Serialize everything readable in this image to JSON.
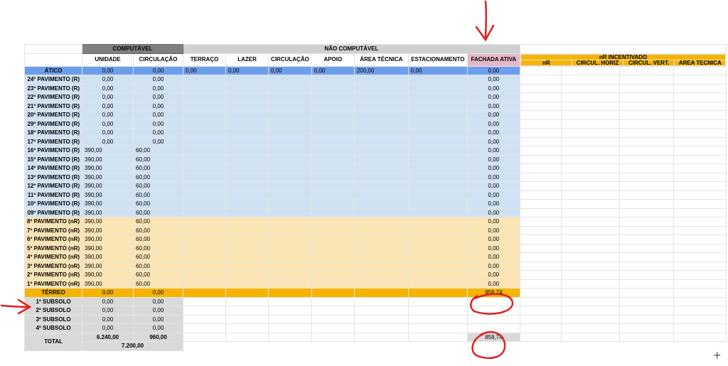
{
  "header": {
    "computavel": "COMPUTÁVEL",
    "nao_computavel": "NÃO COMPUTÁVEL",
    "nr_incentivado": "nR INCENTIVADO",
    "cols": [
      "UNIDADE",
      "CIRCULAÇÃO",
      "TERRAÇO",
      "LAZER",
      "CIRCULAÇÃO",
      "APOIO",
      "ÁREA TÉCNICA",
      "ESTACIONAMENTO",
      "FACHADA ATIVA"
    ],
    "nr_cols": [
      "nR",
      "CIRCUL. HORIZ",
      "CIRCUL. VERT.",
      "ÁREA TÉCNICA"
    ]
  },
  "rows": [
    {
      "label": "ÁTICO",
      "type": "atico",
      "unidade": "0,00",
      "circulacao": "0,00",
      "terraco": "0,00",
      "lazer": "0,00",
      "circ2": "0,00",
      "apoio": "0,00",
      "area_tecnica": "200,00",
      "estac": "0,00",
      "fachada": "0,00"
    },
    {
      "label": "24º PAVIMENTO (R)",
      "type": "r",
      "unidade": "0,00",
      "circulacao": "0,00",
      "fachada": "0,00"
    },
    {
      "label": "23º PAVIMENTO (R)",
      "type": "r",
      "unidade": "0,00",
      "circulacao": "0,00",
      "fachada": "0,00"
    },
    {
      "label": "22º PAVIMENTO (R)",
      "type": "r",
      "unidade": "0,00",
      "circulacao": "0,00",
      "fachada": "0,00"
    },
    {
      "label": "21º PAVIMENTO (R)",
      "type": "r",
      "unidade": "0,00",
      "circulacao": "0,00",
      "fachada": "0,00"
    },
    {
      "label": "20º PAVIMENTO (R)",
      "type": "r",
      "unidade": "0,00",
      "circulacao": "0,00",
      "fachada": "0,00"
    },
    {
      "label": "29º PAVIMENTO (R)",
      "type": "r",
      "unidade": "0,00",
      "circulacao": "0,00",
      "fachada": "0,00"
    },
    {
      "label": "18º PAVIMENTO (R)",
      "type": "r",
      "unidade": "0,00",
      "circulacao": "0,00",
      "fachada": "0,00"
    },
    {
      "label": "17º PAVIMENTO (R)",
      "type": "r",
      "unidade": "0,00",
      "circulacao": "0,00",
      "fachada": "0,00"
    },
    {
      "label": "16º PAVIMENTO (R)",
      "type": "r",
      "unidade": "390,00",
      "circulacao": "60,00",
      "fachada": "0,00"
    },
    {
      "label": "15º PAVIMENTO (R)",
      "type": "r",
      "unidade": "390,00",
      "circulacao": "60,00",
      "fachada": "0,00"
    },
    {
      "label": "14º PAVIMENTO (R)",
      "type": "r",
      "unidade": "390,00",
      "circulacao": "60,00",
      "fachada": "0,00"
    },
    {
      "label": "13º PAVIMENTO (R)",
      "type": "r",
      "unidade": "390,00",
      "circulacao": "60,00",
      "fachada": "0,00"
    },
    {
      "label": "12º PAVIMENTO (R)",
      "type": "r",
      "unidade": "390,00",
      "circulacao": "60,00",
      "fachada": "0,00"
    },
    {
      "label": "11º PAVIMENTO (R)",
      "type": "r",
      "unidade": "390,00",
      "circulacao": "60,00",
      "fachada": "0,00"
    },
    {
      "label": "10º PAVIMENTO (R)",
      "type": "r",
      "unidade": "390,00",
      "circulacao": "60,00",
      "fachada": "0,00"
    },
    {
      "label": "09º PAVIMENTO (R)",
      "type": "r",
      "unidade": "390,00",
      "circulacao": "60,00",
      "fachada": "0,00"
    },
    {
      "label": "8º PAVIMENTO (nR)",
      "type": "nr",
      "unidade": "390,00",
      "circulacao": "60,00",
      "fachada": "0,00"
    },
    {
      "label": "7º PAVIMENTO (nR)",
      "type": "nr",
      "unidade": "390,00",
      "circulacao": "60,00",
      "fachada": "0,00"
    },
    {
      "label": "6º PAVIMENTO (nR)",
      "type": "nr",
      "unidade": "390,00",
      "circulacao": "60,00",
      "fachada": "0,00"
    },
    {
      "label": "5º PAVIMENTO (nR)",
      "type": "nr",
      "unidade": "390,00",
      "circulacao": "60,00",
      "fachada": "0,00"
    },
    {
      "label": "4º PAVIMENTO (nR)",
      "type": "nr",
      "unidade": "390,00",
      "circulacao": "60,00",
      "fachada": "0,00"
    },
    {
      "label": "3º PAVIMENTO (nR)",
      "type": "nr",
      "unidade": "390,00",
      "circulacao": "60,00",
      "fachada": "0,00"
    },
    {
      "label": "2º PAVIMENTO (nR)",
      "type": "nr",
      "unidade": "390,00",
      "circulacao": "60,00",
      "fachada": "0,00"
    },
    {
      "label": "1º PAVIMENTO (nR)",
      "type": "nr",
      "unidade": "390,00",
      "circulacao": "60,00",
      "fachada": "0,00"
    },
    {
      "label": "TÉRREO",
      "type": "terreo",
      "unidade": "0,00",
      "circulacao": "0,00",
      "fachada": "858,74"
    },
    {
      "label": "1º SUBSOLO",
      "type": "sub",
      "unidade": "0,00",
      "circulacao": "0,00"
    },
    {
      "label": "2º SUBSOLO",
      "type": "sub",
      "unidade": "0,00",
      "circulacao": "0,00"
    },
    {
      "label": "3º SUBSOLO",
      "type": "sub",
      "unidade": "0,00",
      "circulacao": "0,00"
    },
    {
      "label": "4º SUBSOLO",
      "type": "sub",
      "unidade": "0,00",
      "circulacao": "0,00"
    }
  ],
  "total": {
    "label": "TOTAL",
    "unidade": "6.240,00",
    "circulacao": "960,00",
    "fachada": "858,74",
    "computavel_sum": "7.200,00"
  },
  "annotations": {
    "color": "#e02020"
  },
  "ui": {
    "add_icon": "+"
  }
}
